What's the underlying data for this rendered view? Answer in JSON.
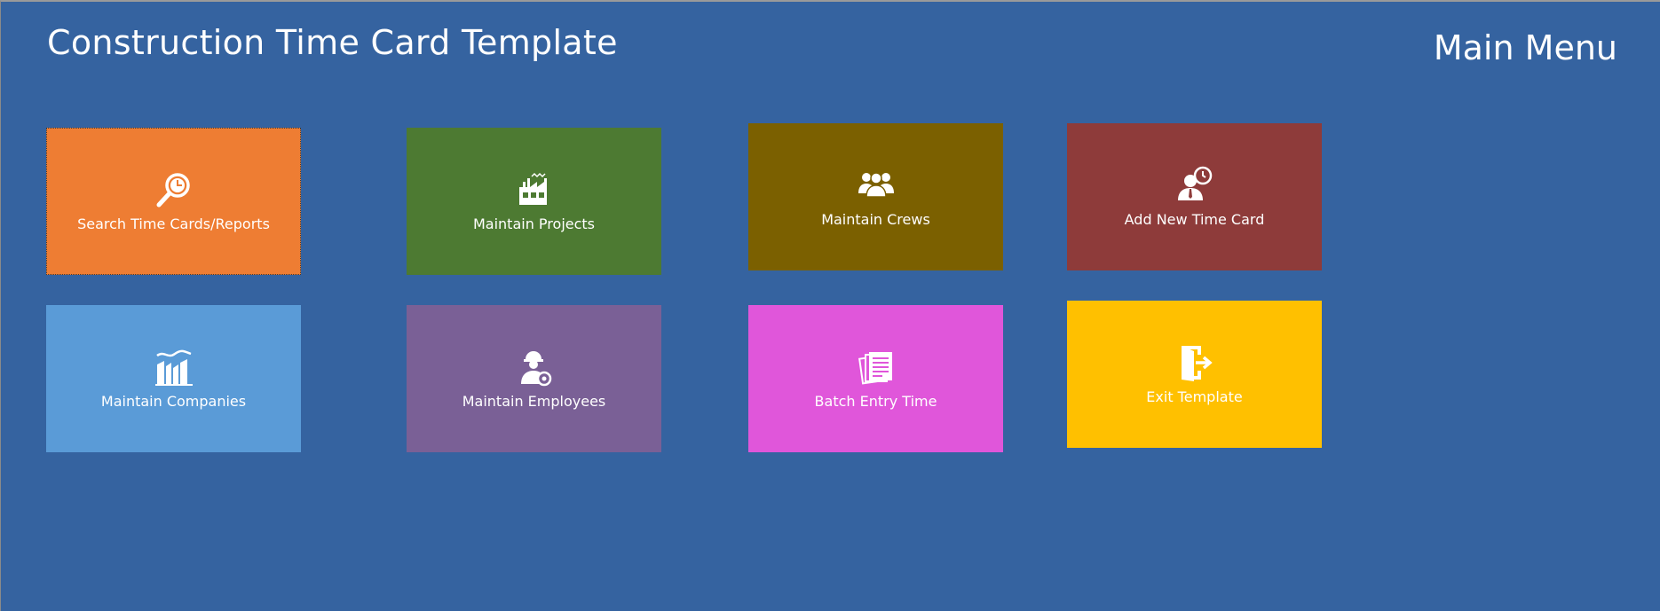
{
  "header": {
    "app_title": "Construction Time Card Template",
    "menu_title": "Main Menu"
  },
  "tiles": [
    {
      "label": "Search Time Cards/Reports",
      "icon": "search-clock-icon",
      "color": "#EE7D33"
    },
    {
      "label": "Maintain Projects",
      "icon": "factory-icon",
      "color": "#4D7A32"
    },
    {
      "label": "Maintain Crews",
      "icon": "group-icon",
      "color": "#7B6000"
    },
    {
      "label": "Add New Time Card",
      "icon": "user-clock-icon",
      "color": "#8E3B3A"
    },
    {
      "label": "Maintain Companies",
      "icon": "buildings-icon",
      "color": "#5A9BD7"
    },
    {
      "label": "Maintain Employees",
      "icon": "worker-gear-icon",
      "color": "#7A6096"
    },
    {
      "label": "Batch Entry Time",
      "icon": "documents-icon",
      "color": "#E056DA"
    },
    {
      "label": "Exit Template",
      "icon": "exit-door-icon",
      "color": "#FFC000"
    }
  ]
}
